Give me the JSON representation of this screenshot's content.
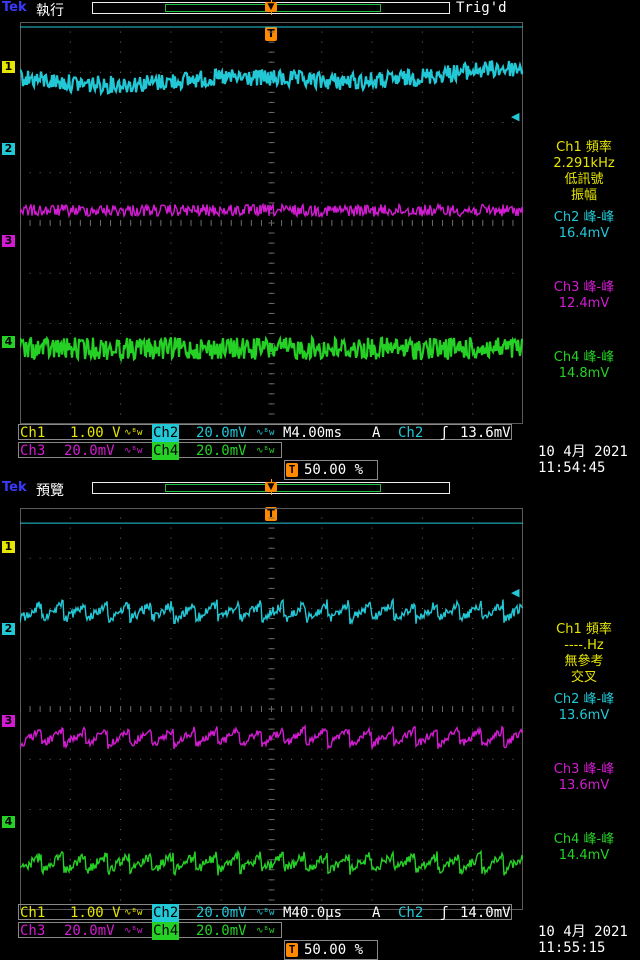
{
  "brand": "Tek",
  "screens": [
    {
      "mode": "執行",
      "trigger_status": "Trig'd",
      "trigger_marker": "T",
      "channel_markers": [
        "1",
        "2",
        "3",
        "4"
      ],
      "measurements": {
        "ch1_label": "Ch1 頻率",
        "ch1_value": "2.291kHz",
        "ch1_note1": "低訊號",
        "ch1_note2": "振幅",
        "ch2_label": "Ch2 峰-峰",
        "ch2_value": "16.4mV",
        "ch3_label": "Ch3 峰-峰",
        "ch3_value": "12.4mV",
        "ch4_label": "Ch4 峰-峰",
        "ch4_value": "14.8mV"
      },
      "status": {
        "ch1": "Ch1",
        "ch1_scale": "1.00 V",
        "ch2": "Ch2",
        "ch2_scale": "20.0mV",
        "timebase": "M4.00ms",
        "trig_mode": "A",
        "trig_src": "Ch2",
        "trig_level": "13.6mV",
        "ch3": "Ch3",
        "ch3_scale": "20.0mV",
        "ch4": "Ch4",
        "ch4_scale": "20.0mV",
        "coupling_glyph": "∿ᴮw",
        "slope_glyph": "ʃ",
        "trigger_position": "50.00 %",
        "date": "10 4月  2021",
        "time": "11:54:45"
      },
      "traces": {
        "ch1": {
          "color": "#e6e600",
          "level_div": -5.2,
          "noise": 0.05,
          "wave": "flat"
        },
        "ch2": {
          "color": "#22c8d6",
          "level_div": -2.9,
          "noise": 0.22,
          "wave": "slow"
        },
        "ch3": {
          "color": "#d21cd2",
          "level_div": -0.25,
          "noise": 0.15,
          "wave": "flat"
        },
        "ch4": {
          "color": "#26d126",
          "level_div": 2.5,
          "noise": 0.28,
          "wave": "flat"
        }
      }
    },
    {
      "mode": "預覽",
      "trigger_status": "",
      "trigger_marker": "T",
      "channel_markers": [
        "1",
        "2",
        "3",
        "4"
      ],
      "measurements": {
        "ch1_label": "Ch1 頻率",
        "ch1_value": "----.Hz",
        "ch1_note1": "無參考",
        "ch1_note2": "交叉",
        "ch2_label": "Ch2 峰-峰",
        "ch2_value": "13.6mV",
        "ch3_label": "Ch3 峰-峰",
        "ch3_value": "13.6mV",
        "ch4_label": "Ch4 峰-峰",
        "ch4_value": "14.4mV"
      },
      "status": {
        "ch1": "Ch1",
        "ch1_scale": "1.00 V",
        "ch2": "Ch2",
        "ch2_scale": "20.0mV",
        "timebase": "M40.0µs",
        "trig_mode": "A",
        "trig_src": "Ch2",
        "trig_level": "14.0mV",
        "ch3": "Ch3",
        "ch3_scale": "20.0mV",
        "ch4": "Ch4",
        "ch4_scale": "20.0mV",
        "coupling_glyph": "∿ᴮw",
        "slope_glyph": "ʃ",
        "trigger_position": "50.00 %",
        "date": "10 4月  2021",
        "time": "11:55:15"
      },
      "traces": {
        "ch1": {
          "color": "#e6e600",
          "level_div": -5.2,
          "noise": 0.05,
          "wave": "flat"
        },
        "ch2": {
          "color": "#22c8d6",
          "level_div": -1.9,
          "noise": 0.12,
          "wave": "saw"
        },
        "ch3": {
          "color": "#d21cd2",
          "level_div": 0.6,
          "noise": 0.1,
          "wave": "saw"
        },
        "ch4": {
          "color": "#26d126",
          "level_div": 3.1,
          "noise": 0.12,
          "wave": "saw"
        }
      }
    }
  ]
}
